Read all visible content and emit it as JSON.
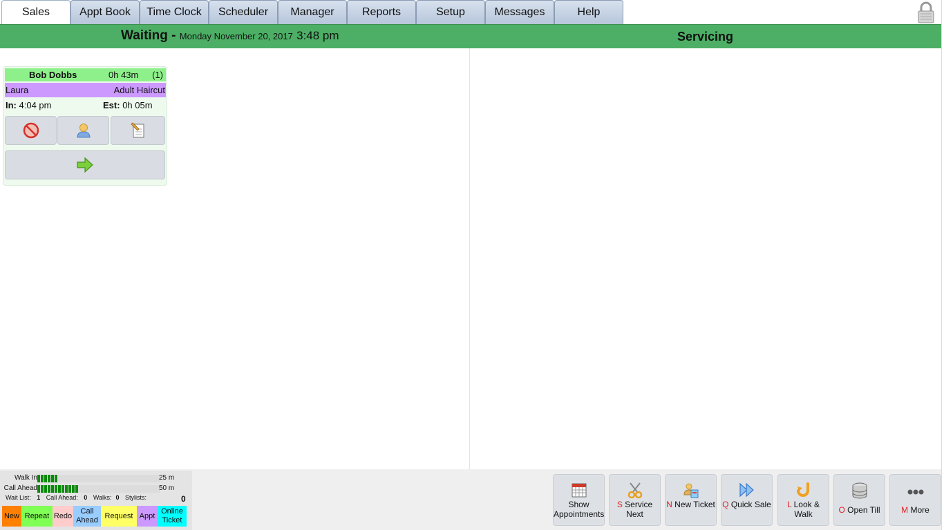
{
  "tabs": [
    {
      "label": "Sales",
      "active": true
    },
    {
      "label": "Appt Book"
    },
    {
      "label": "Time Clock"
    },
    {
      "label": "Scheduler"
    },
    {
      "label": "Manager"
    },
    {
      "label": "Reports"
    },
    {
      "label": "Setup"
    },
    {
      "label": "Messages"
    },
    {
      "label": "Help"
    }
  ],
  "header": {
    "waiting_label": "Waiting -",
    "date": "Monday November 20, 2017",
    "time": "3:48 pm",
    "servicing_label": "Servicing",
    "bar_color": "#4caf65"
  },
  "ticket": {
    "customer": "Bob Dobbs",
    "wait": "0h 43m",
    "count": "(1)",
    "stylist": "Laura",
    "service": "Adult Haircut",
    "in_label": "In:",
    "in_time": "4:04 pm",
    "est_label": "Est:",
    "est_time": "0h 05m",
    "buttons": [
      "cancel-icon",
      "person-icon",
      "edit-note-icon",
      "arrow-right-icon"
    ]
  },
  "stats": {
    "walk_in": {
      "label": "Walk In",
      "minutes": "25 m",
      "level": 0.17
    },
    "call_ahead": {
      "label": "Call Ahead",
      "minutes": "50 m",
      "level": 0.33
    },
    "wait_list": {
      "label": "Wait List:",
      "value": "1"
    },
    "call_ahead_count": {
      "label": "Call Ahead:",
      "value": "0"
    },
    "walks": {
      "label": "Walks:",
      "value": "0"
    },
    "stylists": {
      "label": "Stylists:",
      "value": "0"
    }
  },
  "legend": [
    {
      "label": "New",
      "color": "#ff7f00",
      "width": 28
    },
    {
      "label": "Repeat",
      "color": "#80ff55",
      "width": 45
    },
    {
      "label": "Redo",
      "color": "#ffcccc",
      "width": 30
    },
    {
      "label": "Call Ahead",
      "color": "#99ccff",
      "width": 40
    },
    {
      "label": "Request",
      "color": "#ffff66",
      "width": 52
    },
    {
      "label": "Appt",
      "color": "#cc99ff",
      "width": 30
    },
    {
      "label": "Online Ticket",
      "color": "#00ffff",
      "width": 42
    }
  ],
  "actions": [
    {
      "key": "",
      "label": "Show Appointments",
      "icon": "calendar-icon"
    },
    {
      "key": "S",
      "label": "Service Next",
      "icon": "scissors-icon"
    },
    {
      "key": "N",
      "label": "New Ticket",
      "icon": "new-ticket-icon"
    },
    {
      "key": "Q",
      "label": "Quick Sale",
      "icon": "fast-forward-icon"
    },
    {
      "key": "L",
      "label": "Look & Walk",
      "icon": "look-walk-icon"
    },
    {
      "key": "O",
      "label": "Open Till",
      "icon": "till-icon"
    },
    {
      "key": "M",
      "label": "More",
      "icon": "more-dots-icon"
    }
  ]
}
